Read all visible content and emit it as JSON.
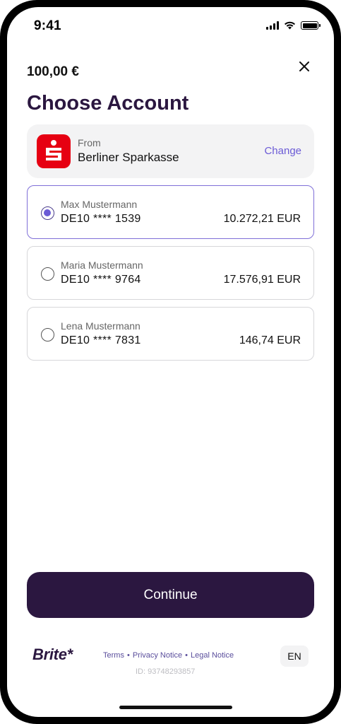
{
  "status_bar": {
    "time": "9:41"
  },
  "payment": {
    "amount": "100,00 €"
  },
  "page": {
    "title": "Choose Account"
  },
  "bank": {
    "from_label": "From",
    "name": "Berliner Sparkasse",
    "change_label": "Change",
    "logo_color": "#e60012"
  },
  "accounts": [
    {
      "name": "Max Mustermann",
      "iban": "DE10 **** 1539",
      "balance": "10.272,21 EUR",
      "selected": true
    },
    {
      "name": "Maria Mustermann",
      "iban": "DE10 **** 9764",
      "balance": "17.576,91 EUR",
      "selected": false
    },
    {
      "name": "Lena Mustermann",
      "iban": "DE10 **** 7831",
      "balance": "146,74 EUR",
      "selected": false
    }
  ],
  "actions": {
    "continue_label": "Continue"
  },
  "footer": {
    "brand": "Brite*",
    "links": [
      "Terms",
      "Privacy Notice",
      "Legal Notice"
    ],
    "separator": "•",
    "id_text": "ID: 93748293857",
    "language": "EN"
  },
  "colors": {
    "primary": "#2b1740",
    "accent": "#6b5bd6"
  },
  "icons": {
    "close": "close-icon",
    "radio_selected": "radio-selected-icon",
    "radio_empty": "radio-empty-icon"
  }
}
